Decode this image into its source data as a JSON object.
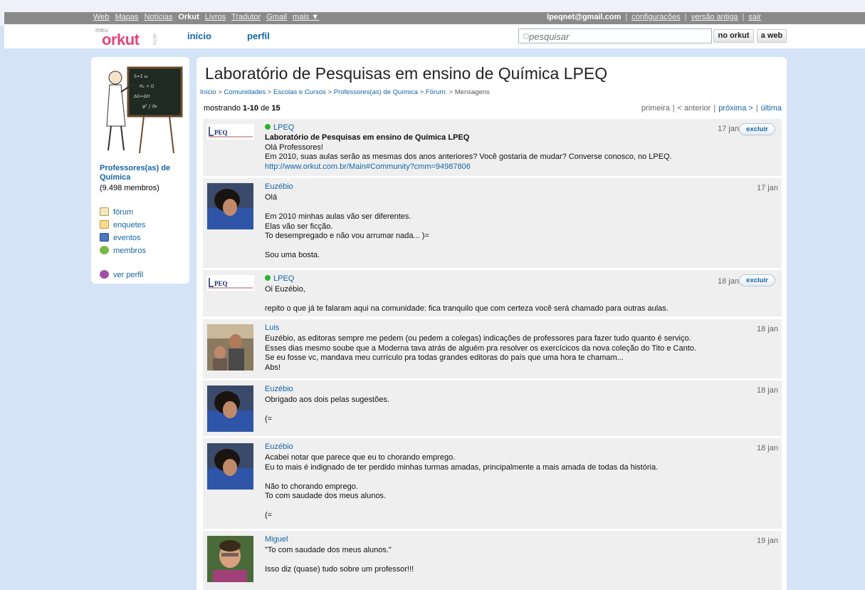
{
  "topnav": {
    "items": [
      "Web",
      "Mapas",
      "Notícias",
      "Orkut",
      "Livros",
      "Tradutor",
      "Gmail",
      "mais ▼"
    ],
    "current": "Orkut"
  },
  "account": {
    "email": "lpeqnet@gmail.com",
    "settings": "configurações",
    "old_version": "versão antiga",
    "logout": "sair"
  },
  "header": {
    "logo_meu": "meu",
    "logo_text": "orkut",
    "logo_beta": "BETA",
    "nav_home": "início",
    "nav_profile": "perfil",
    "search_placeholder": "pesquisar",
    "btn_orkut": "no orkut",
    "btn_web": "a web"
  },
  "community": {
    "name": "Professores(as) de Química",
    "members": "(9.498 membros)",
    "menu": [
      "fórum",
      "enquetes",
      "eventos",
      "membros"
    ],
    "view_profile": "ver perfil"
  },
  "topic": {
    "title": "Laboratório de Pesquisas em ensino de Química LPEQ",
    "breadcrumb": [
      "Início",
      "Comunidades",
      "Escolas e Cursos",
      "Professores(as) de Química",
      "Fórum:",
      "Mensagens"
    ],
    "showing_prefix": "mostrando ",
    "showing_range": "1-10",
    "showing_of": " de ",
    "showing_total": "15",
    "pager": {
      "first": "primeira",
      "prev": "< anterior",
      "next": "próxima >",
      "last": "última"
    },
    "delete_label": "excluir"
  },
  "posts": [
    {
      "author": "LPEQ",
      "online": true,
      "date": "17 jan",
      "deletable": true,
      "lines": [
        "Laboratório de Pesquisas em ensino de Química LPEQ",
        "Olá Professores!",
        "Em 2010, suas aulas serão as mesmas dos anos anteriores? Você gostaria de mudar? Converse conosco, no LPEQ.",
        "http://www.orkut.com.br/Main#Community?cmm=94987806"
      ]
    },
    {
      "author": "Euzébio",
      "date": "17 jan",
      "lines": [
        "Olá",
        "",
        "Em 2010 minhas aulas vão ser diferentes.",
        "Elas vão ser ficção.",
        "To desempregado e não vou arrumar nada... )=",
        "",
        "Sou uma bosta."
      ]
    },
    {
      "author": "LPEQ",
      "online": true,
      "date": "18 jan",
      "deletable": true,
      "lines": [
        "Oi Euzébio,",
        "",
        "repito o que já te falaram aqui na comunidade: fica tranquilo que com certeza você será chamado para outras aulas."
      ]
    },
    {
      "author": "Luis",
      "date": "18 jan",
      "lines": [
        "Euzébio, as editoras sempre me pedem (ou pedem a colegas) indicações de professores para fazer tudo quanto é serviço.",
        "Esses dias mesmo soube que a Moderna tava atrás de alguém pra resolver os exercícicos da nova coleção do Tito e Canto.",
        "Se eu fosse vc, mandava meu currículo pra todas grandes editoras do país que uma hora te chamam...",
        "Abs!"
      ]
    },
    {
      "author": "Euzébio",
      "date": "18 jan",
      "lines": [
        "Obrigado aos dois pelas sugestões.",
        "",
        "(="
      ]
    },
    {
      "author": "Euzébio",
      "date": "18 jan",
      "lines": [
        "Acabei notar que parece que eu to chorando emprego.",
        "Eu to mais é indignado de ter perdido minhas turmas amadas, principalmente a mais amada de todas da história.",
        "",
        "Não to chorando emprego.",
        "To com saudade dos meus alunos.",
        "",
        "(="
      ]
    },
    {
      "author": "Miguel",
      "date": "19 jan",
      "lines": [
        "\"To com saudade dos meus alunos.\"",
        "",
        "Isso diz (quase) tudo sobre um professor!!!"
      ]
    }
  ],
  "colors": {
    "link": "#1565a5",
    "online": "#2db22d",
    "page_bg": "#d5e3f7",
    "post_bg": "#efefef",
    "logo": "#e0467c"
  }
}
